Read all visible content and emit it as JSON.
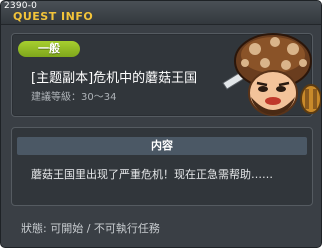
{
  "window": {
    "quest_id": "2390-0",
    "title": "QUEST INFO"
  },
  "quest": {
    "category_badge": "一般",
    "name": "[主题副本]危机中的蘑菇王国",
    "recommended_level": "建議等級：30～34",
    "npc_icon": "mushroom-npc-icon"
  },
  "content": {
    "header": "内容",
    "text": "蘑菇王国里出现了严重危机！现在正急需帮助……"
  },
  "status": {
    "text": "狀態: 可開始 / 不可執行任務"
  },
  "colors": {
    "title": "#f3c43a",
    "badge": "#8fbb22",
    "window_bg": "#3a3f45",
    "panel_bg": "#31363b",
    "header_bg": "#4b5865"
  }
}
